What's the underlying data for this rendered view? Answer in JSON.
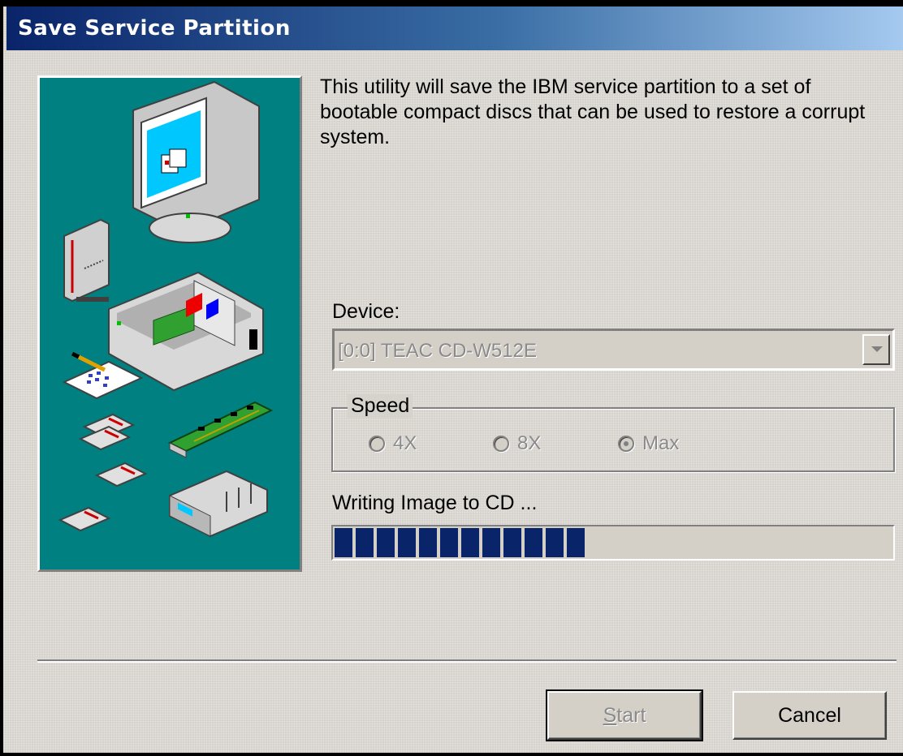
{
  "window": {
    "title": "Save Service Partition"
  },
  "description": "This utility will save the IBM service partition to a set of bootable compact discs that can be used to restore a corrupt system.",
  "device": {
    "label": "Device:",
    "selected_value": "[0:0] TEAC CD-W512E"
  },
  "speed": {
    "legend": "Speed",
    "options": [
      {
        "label": "4X",
        "checked": false
      },
      {
        "label": "8X",
        "checked": false
      },
      {
        "label": "Max",
        "checked": true
      }
    ]
  },
  "progress": {
    "label": "Writing Image to CD ...",
    "fraction": 0.46
  },
  "buttons": {
    "start_mnemonic": "S",
    "start_rest": "tart",
    "cancel": "Cancel"
  },
  "colors": {
    "title_bar_start": "#0a246a",
    "title_bar_end": "#a6caf0",
    "progress_fill": "#0a246a",
    "illustration_bg": "#008080"
  },
  "icons": [
    "hardware-illustration-icon",
    "dropdown-arrow-icon"
  ]
}
